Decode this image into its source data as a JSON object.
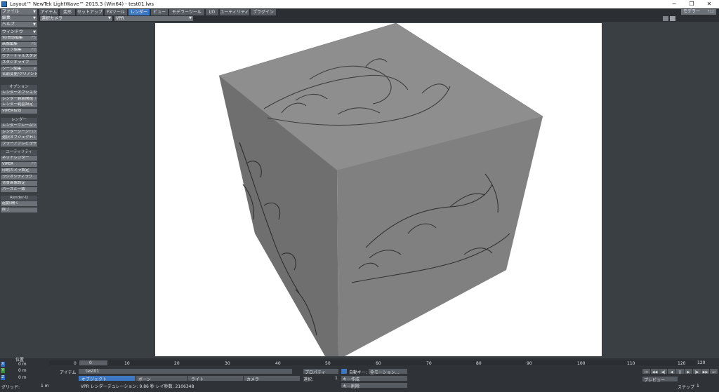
{
  "window": {
    "title": "Layout™ NewTek LightWave™ 2015.3 (Win64) - test01.lws",
    "minimize": "─",
    "maximize": "❐",
    "close": "✕"
  },
  "left_menu": {
    "file": "ファイル",
    "edit": "編集",
    "help": "ヘルプ",
    "window_header": "ウィンドウ",
    "items_top": [
      {
        "label": "色/質感編集",
        "key": "F5"
      },
      {
        "label": "画像編集",
        "key": "F6"
      },
      {
        "label": "グラフ編集",
        "key": "F2"
      },
      {
        "label": "ヴァーチャルスタジオ",
        "key": "▾"
      },
      {
        "label": "スタジオライブ",
        "key": ""
      },
      {
        "label": "シーン編集",
        "key": "▾"
      },
      {
        "label": "名前変更/クリアント",
        "key": ""
      }
    ],
    "options_title": "オプション",
    "options": [
      {
        "label": "レンダーオプション",
        "key": "F"
      },
      {
        "label": "レンダー範囲開始",
        "key": "l"
      },
      {
        "label": "レンダー範囲設定",
        "key": ""
      },
      {
        "label": "VIPER有効",
        "key": ""
      }
    ],
    "render_title": "レンダー",
    "render": [
      {
        "label": "レンダーフレーム",
        "key": "F9"
      },
      {
        "label": "レンダーシーン",
        "key": "F10"
      },
      {
        "label": "選択オブジェクト",
        "key": "F11"
      },
      {
        "label": "フラーアプレビュー",
        "key": "⌃F9"
      }
    ],
    "utility_title": "ユーティリティ",
    "utility": [
      {
        "label": "ネットレンダー",
        "key": ""
      },
      {
        "label": "VIPER",
        "key": "F7"
      },
      {
        "label": "印刷カメラ設定",
        "key": ""
      },
      {
        "label": "ラジオシティラグ",
        "key": ""
      },
      {
        "label": "背景画像設定",
        "key": ""
      },
      {
        "label": "パースと一致",
        "key": ""
      }
    ],
    "renderq_title": "Render-Q",
    "renderq": [
      {
        "label": "起動/開く",
        "key": ""
      },
      {
        "label": "終了",
        "key": ""
      }
    ]
  },
  "tabs": [
    "アイテム",
    "変形",
    "セットアップ",
    "FXツール",
    "レンダー",
    "ビュー",
    "モデラーツール",
    "I/O",
    "ユーティリティ",
    "プラグイン"
  ],
  "active_tab": "レンダー",
  "modeler_button": "モデラー",
  "modeler_key": "F12",
  "viewport_header": {
    "camera_select": "選択カメラ",
    "vpr_select": "VPR"
  },
  "timeline": {
    "ticks": [
      "0",
      "10",
      "20",
      "30",
      "40",
      "50",
      "60",
      "70",
      "80",
      "90",
      "100",
      "110",
      "120"
    ],
    "end_frame": "120",
    "current_frame": "0",
    "position_label": "位置",
    "axes": [
      {
        "axis": "X",
        "value": "0 m"
      },
      {
        "axis": "Y",
        "value": "0 m"
      },
      {
        "axis": "Z",
        "value": "0 m"
      }
    ],
    "grid_label": "グリッド:",
    "grid_value": "1 m",
    "item_label": "アイテム",
    "item_value": "test01",
    "object_button": "オブジェクト",
    "bone_button": "ボーン",
    "light_button": "ライト",
    "camera_button": "カメラ",
    "property_button": "プロパティ",
    "select_label": "選択:",
    "select_value": "1",
    "auto_key_label": "自動キー:",
    "auto_key_value": "全モーション…",
    "create_key": "キー作成",
    "delete_key": "キー削除",
    "status_text": "VPR レンダーデュレーション: 9.86 秒  レイ秒数: 2106348",
    "preview_label": "プレビュー",
    "step_label": "ステップ",
    "step_value": "1",
    "transport": [
      "⏮",
      "◀◀",
      "◀|",
      "◀",
      "||",
      "▶",
      "|▶",
      "▶▶",
      "⏭"
    ]
  },
  "colors": {
    "accent": "#3c78c4",
    "panel": "#3a3f44",
    "button": "#6b7177",
    "cube_top": "#8e8e8e",
    "cube_left": "#6f6f6f",
    "cube_right": "#808080"
  }
}
